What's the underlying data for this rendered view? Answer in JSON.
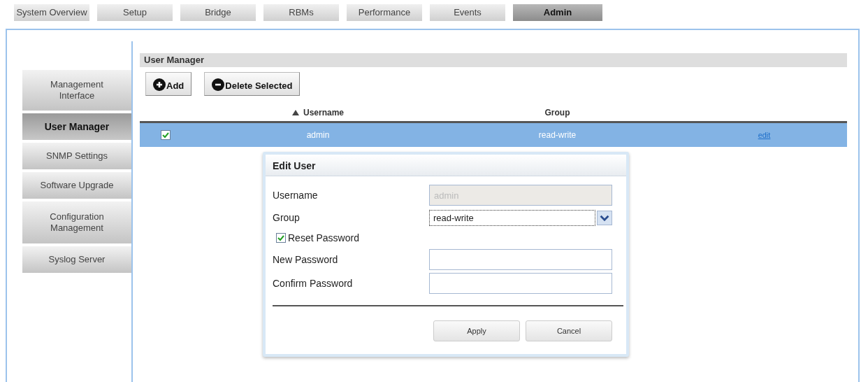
{
  "tabs": [
    {
      "label": "System Overview",
      "selected": false
    },
    {
      "label": "Setup",
      "selected": false
    },
    {
      "label": "Bridge",
      "selected": false
    },
    {
      "label": "RBMs",
      "selected": false
    },
    {
      "label": "Performance",
      "selected": false
    },
    {
      "label": "Events",
      "selected": false
    },
    {
      "label": "Admin",
      "selected": true
    }
  ],
  "sidebar": {
    "items": [
      {
        "label": "Management Interface",
        "selected": false
      },
      {
        "label": "User Manager",
        "selected": true
      },
      {
        "label": "SNMP Settings",
        "selected": false
      },
      {
        "label": "Software Upgrade",
        "selected": false
      },
      {
        "label": "Configuration Management",
        "selected": false
      },
      {
        "label": "Syslog Server",
        "selected": false
      }
    ]
  },
  "section_title": "User Manager",
  "toolbar": [
    {
      "kind": "add",
      "label": "Add"
    },
    {
      "kind": "delete",
      "label": "Delete Selected"
    }
  ],
  "table": {
    "columns": [
      {
        "label": "Username",
        "sorted": true
      },
      {
        "label": "Group",
        "sorted": false
      }
    ],
    "rows": [
      {
        "checked": true,
        "selected": true,
        "username": "admin",
        "group": "read-write",
        "action": "edit"
      }
    ]
  },
  "dialog": {
    "title": "Edit User",
    "fields": [
      {
        "kind": "text",
        "label": "Username",
        "value": "admin",
        "disabled": true
      },
      {
        "kind": "select",
        "label": "Group",
        "value": "read-write"
      },
      {
        "kind": "checkbox",
        "label": "Reset Password",
        "checked": true
      },
      {
        "kind": "password",
        "label": "New Password"
      },
      {
        "kind": "password",
        "label": "Confirm Password"
      }
    ],
    "buttons": [
      "Apply",
      "Cancel"
    ]
  }
}
